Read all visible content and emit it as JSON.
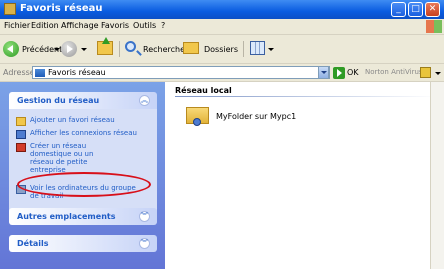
{
  "window": {
    "title": "Favoris réseau"
  },
  "menu": [
    "Fichier",
    "Edition",
    "Affichage",
    "Favoris",
    "Outils",
    "?"
  ],
  "toolbar": {
    "back_label": "Précédente",
    "search_label": "Rechercher",
    "folders_label": "Dossiers"
  },
  "address": {
    "label": "Adresse",
    "value": "Favoris réseau",
    "go_label": "OK",
    "norton_label": "Norton AntiVirus"
  },
  "tasks": {
    "network": {
      "title": "Gestion du réseau",
      "items": [
        {
          "label": "Ajouter un favori réseau",
          "icon": "add-network-place-icon"
        },
        {
          "label": "Afficher les connexions réseau",
          "icon": "network-connections-icon"
        },
        {
          "label": "Créer un réseau domestique ou un réseau de petite entreprise",
          "icon": "home-network-icon"
        },
        {
          "label": "Voir les ordinateurs du groupe de travail",
          "icon": "workgroup-computers-icon"
        }
      ]
    },
    "other_places": {
      "title": "Autres emplacements"
    },
    "details": {
      "title": "Détails"
    }
  },
  "content": {
    "section_title": "Réseau local",
    "items": [
      {
        "label": "MyFolder sur Mypc1",
        "icon": "shared-folder-icon"
      }
    ]
  },
  "colors": {
    "titlebar": "#0a5ce0",
    "task_pane": "#6f8edf",
    "task_link": "#215dc6",
    "highlight": "#d8101a"
  }
}
